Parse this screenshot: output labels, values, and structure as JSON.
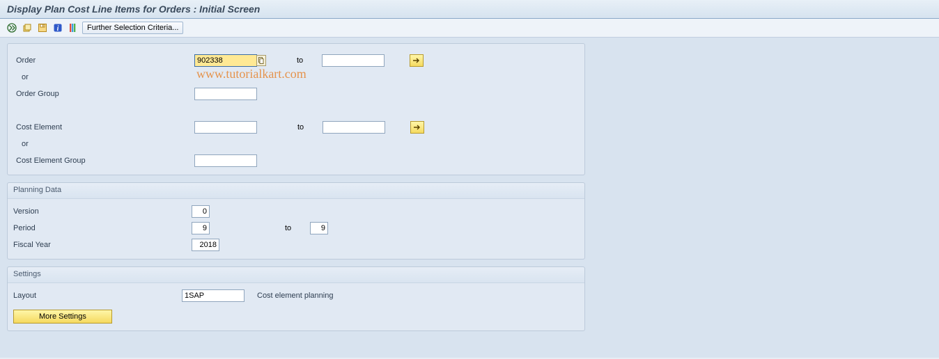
{
  "title": "Display Plan Cost Line Items for Orders : Initial Screen",
  "toolbar": {
    "further_criteria_label": "Further Selection Criteria...",
    "icons": {
      "execute": "execute-icon",
      "variant": "variant-icon",
      "save": "save-icon",
      "info": "info-icon",
      "dsource": "data-source-icon"
    }
  },
  "watermark": "www.tutorialkart.com",
  "fields": {
    "order": {
      "label": "Order",
      "from": "902338",
      "to_label": "to",
      "to": ""
    },
    "or1": "or",
    "order_group": {
      "label": "Order Group",
      "value": ""
    },
    "cost_element": {
      "label": "Cost Element",
      "from": "",
      "to_label": "to",
      "to": ""
    },
    "or2": "or",
    "cost_element_group": {
      "label": "Cost Element Group",
      "value": ""
    }
  },
  "planning_data": {
    "title": "Planning Data",
    "version": {
      "label": "Version",
      "value": "0"
    },
    "period": {
      "label": "Period",
      "from": "9",
      "to_label": "to",
      "to": "9"
    },
    "fiscal_year": {
      "label": "Fiscal Year",
      "value": "2018"
    }
  },
  "settings": {
    "title": "Settings",
    "layout": {
      "label": "Layout",
      "value": "1SAP",
      "desc": "Cost element planning"
    },
    "more_btn": "More Settings"
  }
}
